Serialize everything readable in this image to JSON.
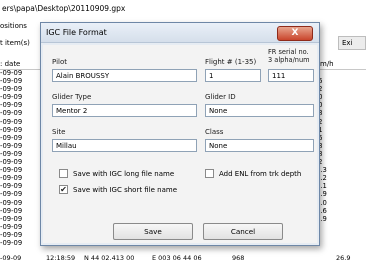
{
  "background": {
    "path": "ers\\papa\\Desktop\\20110909.gpx",
    "left_labels": [
      "ositions",
      "t item(s)"
    ],
    "tab_label": "Exi",
    "header_left": ": date",
    "header_right": "m/h",
    "date_rows": [
      "-09-09",
      "-09-09",
      "-09-09",
      "-09-09",
      "-09-09",
      "-09-09",
      "-09-09",
      "-09-09",
      "-09-09",
      "-09-09",
      "-09-09",
      "-09-09",
      "-09-09",
      "-09-09",
      "-09-09",
      "-09-09",
      "-09-09",
      "-09-09",
      "-09-09",
      "-09-09",
      "-09-09",
      "-09-09"
    ],
    "speed_rows": [
      "0",
      ".6",
      ".2",
      ".0",
      ".0",
      ".8",
      ".2",
      ".1",
      ".6",
      ".8",
      ".8",
      ".2",
      "3.3",
      "6.2",
      "1.1",
      "6.9",
      "7.0",
      "0.6",
      "1.9"
    ],
    "last_row": {
      "date": "-09-09",
      "time": "12:18:59",
      "lat": "N 44 02.413 00",
      "lon": "E 003 06 44 06",
      "alt": "968",
      "speed": "26.9"
    }
  },
  "dialog": {
    "title": "IGC File Format",
    "close_glyph": "X",
    "pilot": {
      "label": "Pilot",
      "value": "Alain BROUSSY"
    },
    "flight": {
      "label": "Flight # (1-35)",
      "value": "1"
    },
    "fr_serial": {
      "label": "FR serial no.",
      "sublabel": "3 alpha/num",
      "value": "111"
    },
    "glider_type": {
      "label": "Glider Type",
      "value": "Mentor 2"
    },
    "glider_id": {
      "label": "Glider ID",
      "value": "None"
    },
    "site": {
      "label": "Site",
      "value": "Millau"
    },
    "class": {
      "label": "Class",
      "value": "None"
    },
    "save_long": {
      "label": "Save with IGC long file name",
      "checked": false
    },
    "add_enl": {
      "label": "Add ENL from trk depth",
      "checked": false
    },
    "save_short": {
      "label": "Save with IGC short file name",
      "checked": true,
      "mark": "✔"
    },
    "save_button": "Save",
    "cancel_button": "Cancel"
  }
}
